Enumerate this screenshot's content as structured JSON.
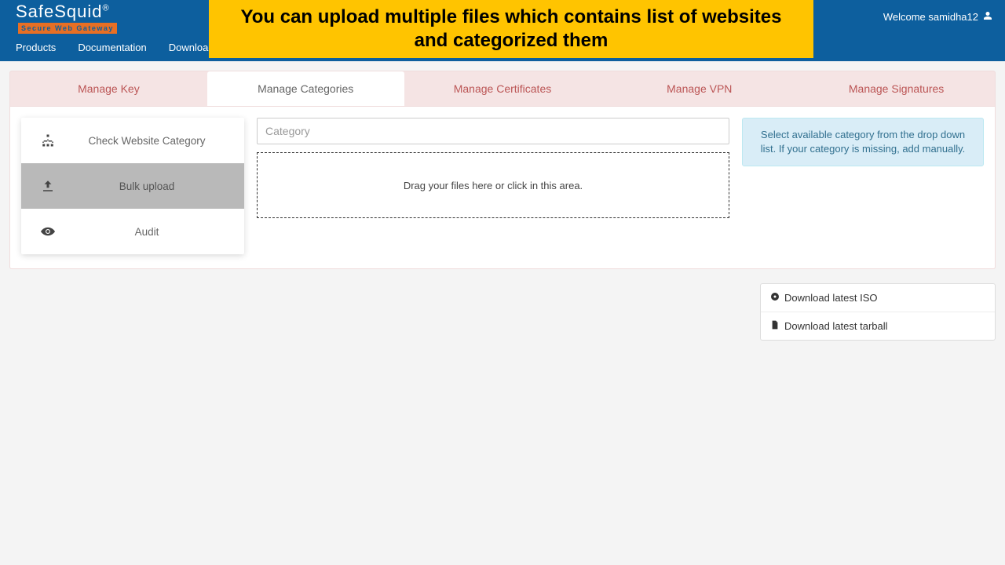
{
  "brand": {
    "name": "SafeSquid",
    "reg": "®",
    "tagline": "Secure Web Gateway"
  },
  "topnav": {
    "products": "Products",
    "documentation": "Documentation",
    "downloads": "Downloads"
  },
  "banner": "You can upload multiple files which contains list of websites and categorized them",
  "welcome": {
    "prefix": "Welcome ",
    "user": "samidha12"
  },
  "tabs": {
    "key": "Manage Key",
    "categories": "Manage Categories",
    "certificates": "Manage Certificates",
    "vpn": "Manage VPN",
    "signatures": "Manage Signatures"
  },
  "sidenav": {
    "check": "Check Website Category",
    "bulk": "Bulk upload",
    "audit": "Audit"
  },
  "category_placeholder": "Category",
  "dropzone": "Drag your files here or click in this area.",
  "hint": "Select available category from the drop down list. If your category is missing, add manually.",
  "downloads": {
    "iso": "Download latest ISO",
    "tarball": "Download latest tarball"
  }
}
